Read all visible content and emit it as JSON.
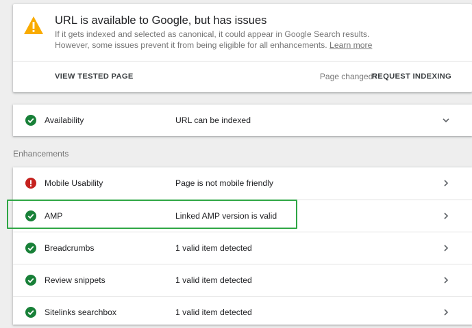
{
  "status": {
    "title": "URL is available to Google, but has issues",
    "desc_line1": "If it gets indexed and selected as canonical, it could appear in Google Search results.",
    "desc_line2": "However, some issues prevent it from being eligible for all enhancements.",
    "learn_more": "Learn more",
    "view_tested_page": "VIEW TESTED PAGE",
    "page_changed": "Page changed?",
    "request_indexing": "REQUEST INDEXING",
    "icon": "warning-icon"
  },
  "availability": {
    "label": "Availability",
    "status": "URL can be indexed",
    "icon": "check-circle-icon",
    "expand_icon": "chevron-down-icon"
  },
  "enhancements": {
    "heading": "Enhancements",
    "items": [
      {
        "label": "Mobile Usability",
        "status": "Page is not mobile friendly",
        "icon": "error-circle-icon"
      },
      {
        "label": "AMP",
        "status": "Linked AMP version is valid",
        "icon": "check-circle-icon"
      },
      {
        "label": "Breadcrumbs",
        "status": "1 valid item detected",
        "icon": "check-circle-icon"
      },
      {
        "label": "Review snippets",
        "status": "1 valid item detected",
        "icon": "check-circle-icon"
      },
      {
        "label": "Sitelinks searchbox",
        "status": "1 valid item detected",
        "icon": "check-circle-icon"
      }
    ]
  },
  "colors": {
    "valid": "#188038",
    "error": "#c5221f",
    "warning": "#f9ab00",
    "highlight": "#2ea644"
  }
}
